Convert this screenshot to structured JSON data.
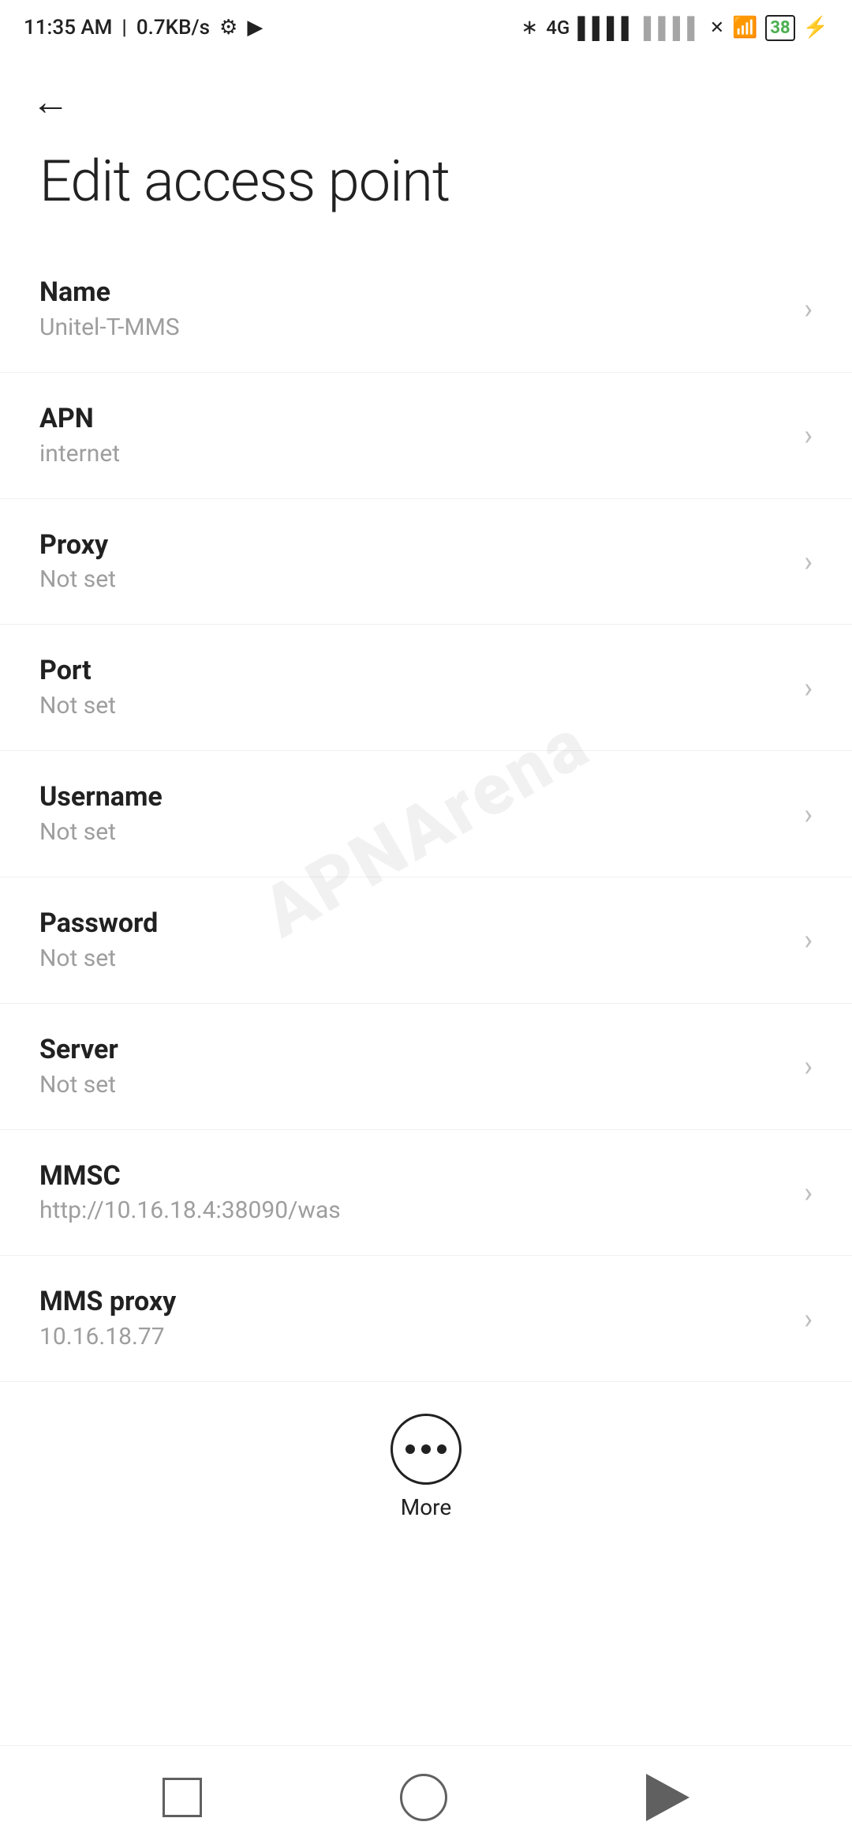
{
  "statusBar": {
    "time": "11:35 AM",
    "speed": "0.7KB/s",
    "settingsIcon": "settings-icon",
    "cameraIcon": "camera-icon",
    "bluetoothIcon": "bluetooth-icon",
    "networkIcon": "network-icon",
    "wifiIcon": "wifi-icon",
    "batteryPercent": "38",
    "batteryIcon": "battery-icon"
  },
  "header": {
    "backLabel": "←",
    "title": "Edit access point"
  },
  "settings": [
    {
      "label": "Name",
      "value": "Unitel-T-MMS"
    },
    {
      "label": "APN",
      "value": "internet"
    },
    {
      "label": "Proxy",
      "value": "Not set"
    },
    {
      "label": "Port",
      "value": "Not set"
    },
    {
      "label": "Username",
      "value": "Not set"
    },
    {
      "label": "Password",
      "value": "Not set"
    },
    {
      "label": "Server",
      "value": "Not set"
    },
    {
      "label": "MMSC",
      "value": "http://10.16.18.4:38090/was"
    },
    {
      "label": "MMS proxy",
      "value": "10.16.18.77"
    }
  ],
  "moreButton": {
    "label": "More"
  },
  "navBar": {
    "homeIcon": "home-icon",
    "backIcon": "back-icon",
    "recentIcon": "recent-icon"
  },
  "watermark": {
    "text": "APNArena"
  }
}
